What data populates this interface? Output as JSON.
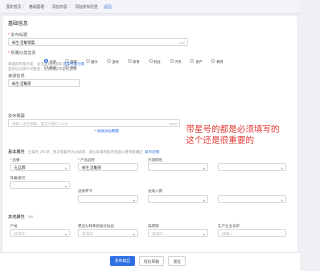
{
  "breadcrumb": [
    "我的首页",
    "基础管理",
    "添加内容",
    "添加发布信息"
  ],
  "breadcrumb_tail": "返回",
  "basic": {
    "section_title": "基础信息",
    "title_label": "发布标题",
    "title_value": "新生活集锦篇",
    "title_count": "6/60",
    "category_label": "所属分类信息",
    "categories": [
      "全部",
      "新闻",
      "娱乐",
      "游戏",
      "体育",
      "科技",
      "汽车",
      "房产",
      "教育",
      "美食",
      "其他"
    ],
    "category_hint": "请选择所属分类，点击可切换选择",
    "category_link": "选择所属分类",
    "tip_line": "发布后分类不可更改，如需调整请重新发布",
    "source_label": "来源信息",
    "source_value": "新生活集锦",
    "summary_label": "发布摘要",
    "summary_placeholder": "请输入发布摘要，建议不超过100字",
    "summary_link": "+ 继续添加摘要",
    "summary_count": "0/100"
  },
  "annotation": {
    "line1": "带星号的都是必须填写的",
    "line2": "这个还是很重要的"
  },
  "attributes": {
    "section_title": "基本属性",
    "section_hint": "已填写 2/8 项，其中带星号为必填项，请认真填写相关信息以便审核通过",
    "section_link": "填写说明",
    "fields": [
      {
        "label": "品牌",
        "value": "无品牌",
        "required": true
      },
      {
        "label": "产品名称",
        "value": "新生活集锦",
        "required": true
      },
      {
        "label": "外观颜色",
        "value": "",
        "required": false
      },
      {
        "label": "",
        "value": "",
        "required": false
      },
      {
        "label": "风格/款式",
        "value": "",
        "required": false
      },
      {
        "label": "适用季节",
        "value": "",
        "required": false
      },
      {
        "label": "适用人群",
        "value": "",
        "required": false
      },
      {
        "label": "",
        "value": "",
        "required": false
      }
    ]
  },
  "sales": {
    "section_title": "其他属性",
    "section_hint": "0/5",
    "fields": [
      {
        "label": "产地",
        "placeholder": "请选择"
      },
      {
        "label": "是否为特殊用途化妆品",
        "placeholder": "请选择"
      },
      {
        "label": "保质期",
        "placeholder": "请选择"
      },
      {
        "label": "生产企业名称",
        "placeholder": "请输入"
      }
    ]
  },
  "footer": {
    "publish_label": "发布商品",
    "draft_label": "保存草稿",
    "preview_label": "预览"
  }
}
